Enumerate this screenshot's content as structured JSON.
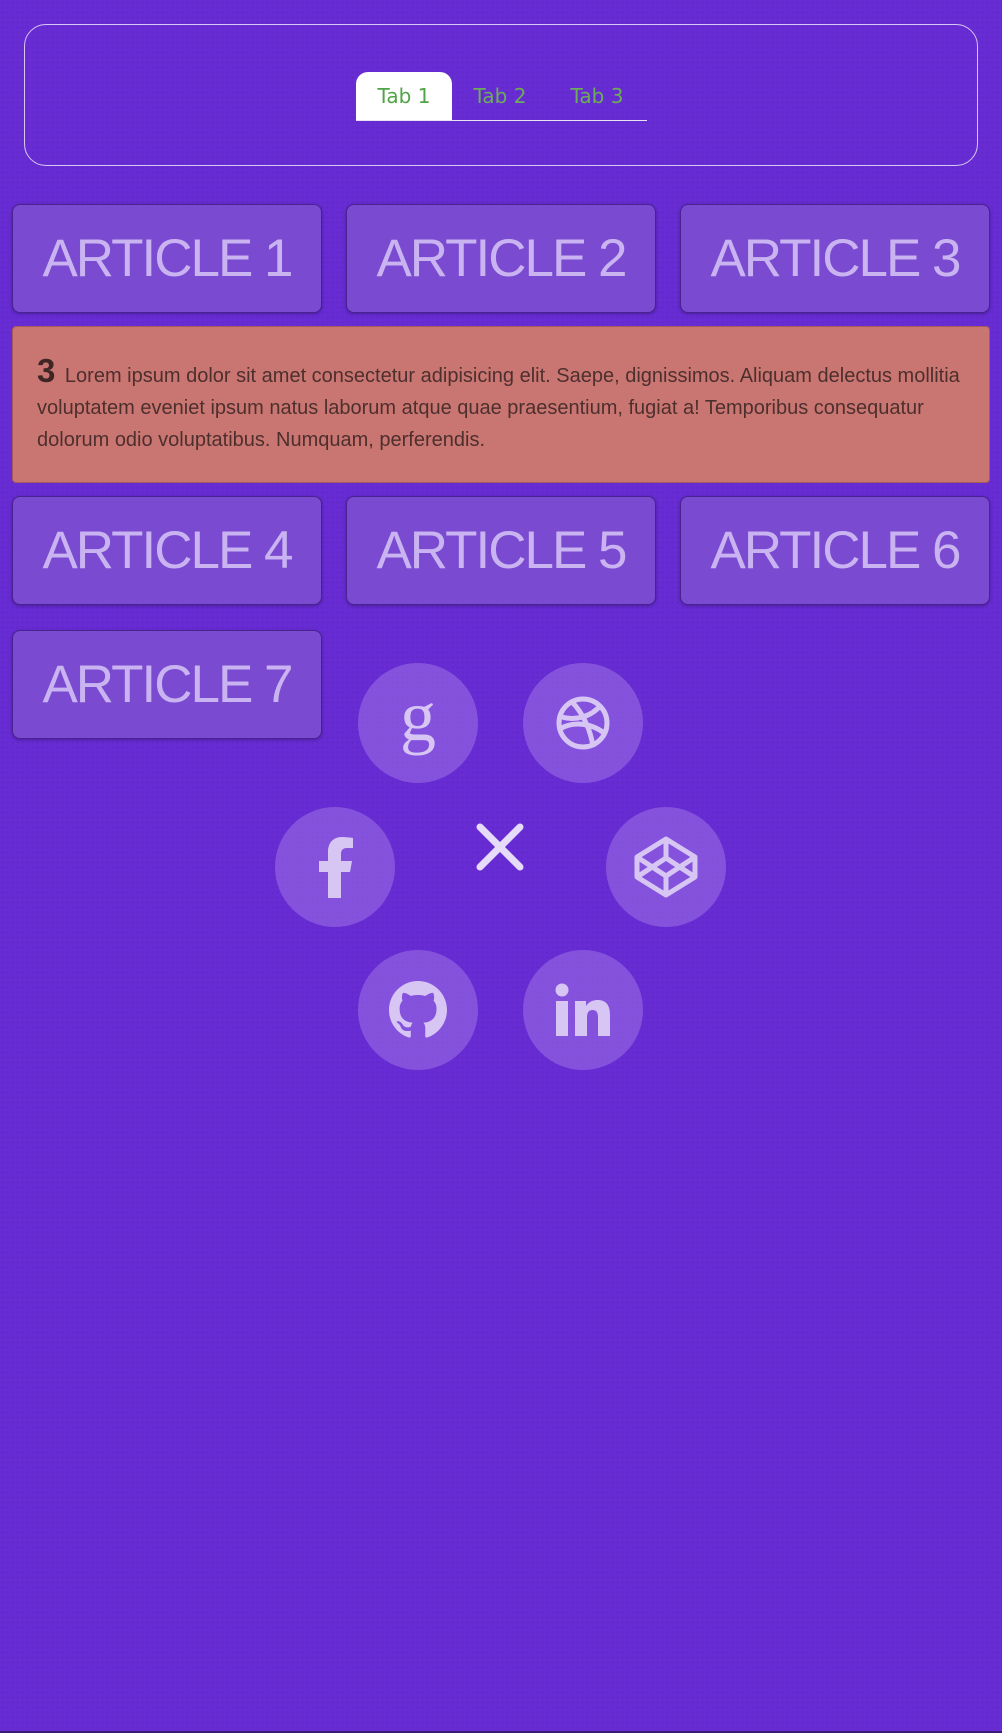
{
  "tabs": {
    "items": [
      {
        "label": "Tab 1",
        "active": true
      },
      {
        "label": "Tab 2",
        "active": false
      },
      {
        "label": "Tab 3",
        "active": false
      }
    ]
  },
  "articles": [
    {
      "label": "ARTICLE 1"
    },
    {
      "label": "ARTICLE 2"
    },
    {
      "label": "ARTICLE 3"
    },
    {
      "label": "ARTICLE 4"
    },
    {
      "label": "ARTICLE 5"
    },
    {
      "label": "ARTICLE 6"
    },
    {
      "label": "ARTICLE 7"
    }
  ],
  "detail": {
    "number": "3",
    "text": "Lorem ipsum dolor sit amet consectetur adipisicing elit. Saepe, dignissimos. Aliquam delectus mollitia voluptatem eveniet ipsum natus laborum atque quae praesentium, fugiat a! Temporibus consequatur dolorum odio voluptatibus. Numquam, perferendis."
  },
  "social_menu": {
    "items": [
      "google-icon",
      "dribbble-icon",
      "facebook-icon",
      "codepen-icon",
      "github-icon",
      "linkedin-icon"
    ],
    "close_icon": "close-icon"
  },
  "colors": {
    "background": "#682cd4",
    "article_card": "#7a4ad1",
    "article_text": "#c9b3f1",
    "detail_panel": "#c97672",
    "tab_text": "#6cad58"
  }
}
